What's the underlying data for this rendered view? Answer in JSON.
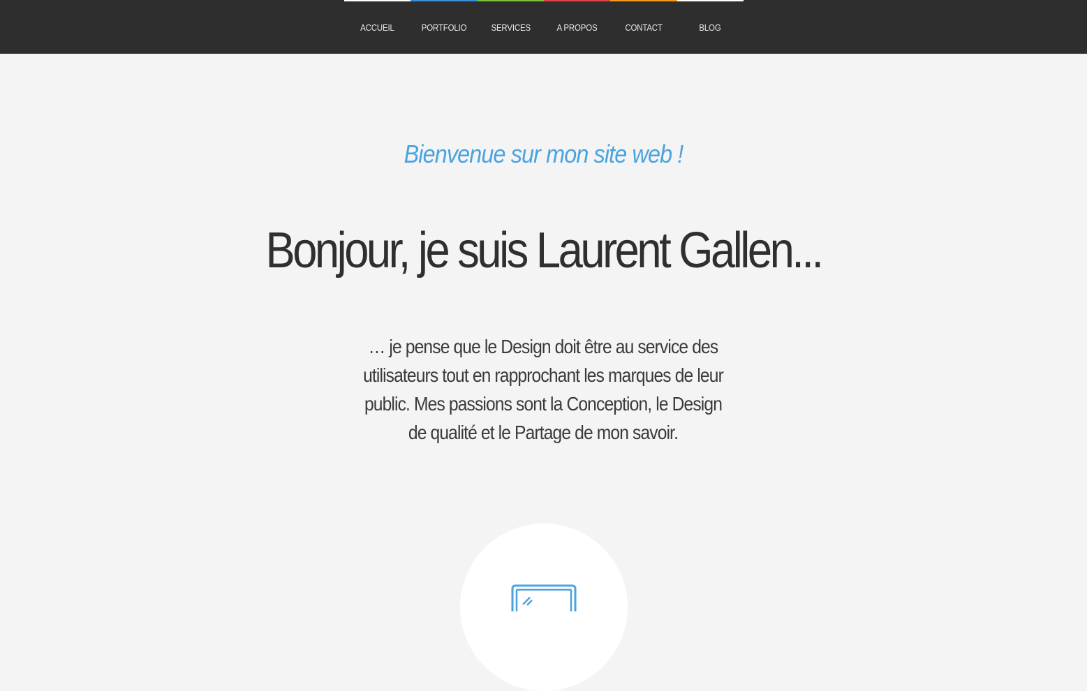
{
  "nav": {
    "items": [
      {
        "label": "ACCUEIL",
        "color": "#ffffff"
      },
      {
        "label": "PORTFOLIO",
        "color": "#3b8fd6"
      },
      {
        "label": "SERVICES",
        "color": "#7cc23a"
      },
      {
        "label": "A PROPOS",
        "color": "#e0424d"
      },
      {
        "label": "CONTACT",
        "color": "#f39c1f"
      },
      {
        "label": "BLOG",
        "color": "#ffffff"
      }
    ]
  },
  "hero": {
    "welcome": "Bienvenue sur mon site web !",
    "headline": "Bonjour, je suis Laurent Gallen...",
    "intro": "… je pense que le Design doit être au service des utilisateurs tout en rapprochant les marques de leur public. Mes passions sont la Conception, le Design de qualité et le Partage de mon savoir."
  },
  "services": {
    "icon": "monitor-icon",
    "accent": "#4aa3df"
  }
}
